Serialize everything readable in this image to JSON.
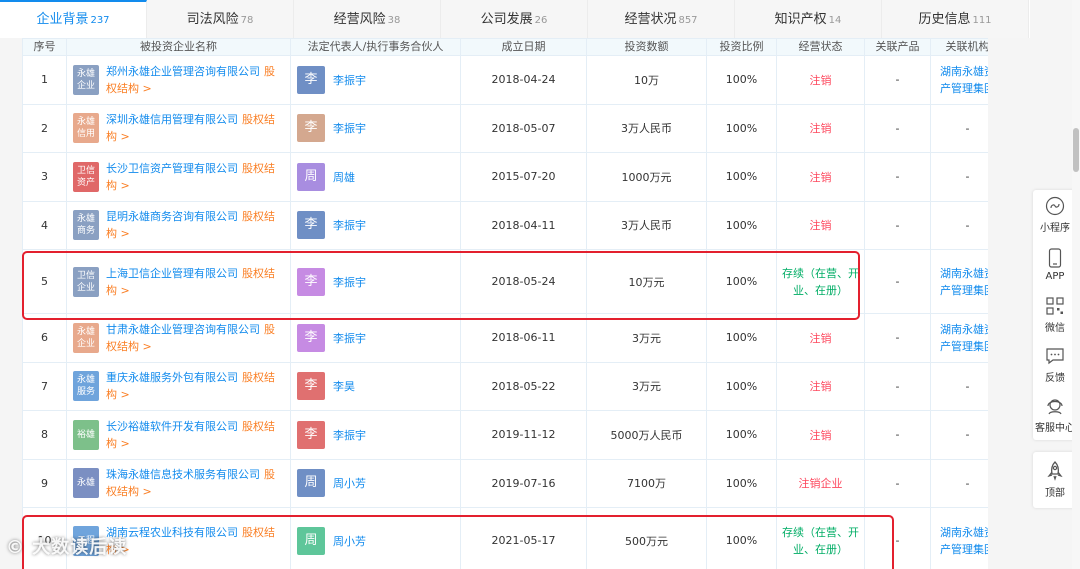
{
  "tabs": [
    {
      "label": "企业背景",
      "count": "237",
      "active": true
    },
    {
      "label": "司法风险",
      "count": "78"
    },
    {
      "label": "经营风险",
      "count": "38"
    },
    {
      "label": "公司发展",
      "count": "26"
    },
    {
      "label": "经营状况",
      "count": "857"
    },
    {
      "label": "知识产权",
      "count": "14"
    },
    {
      "label": "历史信息",
      "count": "111"
    }
  ],
  "table": {
    "headers": [
      "序号",
      "被投资企业名称",
      "法定代表人/执行事务合伙人",
      "成立日期",
      "投资数额",
      "投资比例",
      "经营状态",
      "关联产品",
      "关联机构"
    ],
    "equity_label": "股权结构 >",
    "rows": [
      {
        "no": "1",
        "logo": "永雄企业",
        "logo_color": "#8aa0c2",
        "name": "郑州永雄企业管理咨询有限公司",
        "avatar": "李",
        "avatar_color": "#6f8fc5",
        "person": "李振宇",
        "date": "2018-04-24",
        "amount": "10万",
        "ratio": "100%",
        "status": "注销",
        "status_type": "red",
        "product": "-",
        "org": "湖南永雄资产管理集团"
      },
      {
        "no": "2",
        "logo": "永雄信用",
        "logo_color": "#e8a98c",
        "name": "深圳永雄信用管理有限公司",
        "avatar": "李",
        "avatar_color": "#d4a88f",
        "person": "李振宇",
        "date": "2018-05-07",
        "amount": "3万人民币",
        "ratio": "100%",
        "status": "注销",
        "status_type": "red",
        "product": "-",
        "org": "-"
      },
      {
        "no": "3",
        "logo": "卫信资产",
        "logo_color": "#e06868",
        "name": "长沙卫信资产管理有限公司",
        "avatar": "周",
        "avatar_color": "#a88de0",
        "person": "周雄",
        "date": "2015-07-20",
        "amount": "1000万元",
        "ratio": "100%",
        "status": "注销",
        "status_type": "red",
        "product": "-",
        "org": "-"
      },
      {
        "no": "4",
        "logo": "永雄商务",
        "logo_color": "#8aa0c2",
        "name": "昆明永雄商务咨询有限公司",
        "avatar": "李",
        "avatar_color": "#6f8fc5",
        "person": "李振宇",
        "date": "2018-04-11",
        "amount": "3万人民币",
        "ratio": "100%",
        "status": "注销",
        "status_type": "red",
        "product": "-",
        "org": "-"
      },
      {
        "no": "5",
        "logo": "卫信企业",
        "logo_color": "#8aa0c2",
        "name": "上海卫信企业管理有限公司",
        "avatar": "李",
        "avatar_color": "#c68be3",
        "person": "李振宇",
        "date": "2018-05-24",
        "amount": "10万元",
        "ratio": "100%",
        "status": "存续（在营、开业、在册）",
        "status_type": "green",
        "product": "-",
        "org": "湖南永雄资产管理集团"
      },
      {
        "no": "6",
        "logo": "永雄企业",
        "logo_color": "#e8a98c",
        "name": "甘肃永雄企业管理咨询有限公司",
        "avatar": "李",
        "avatar_color": "#c68be3",
        "person": "李振宇",
        "date": "2018-06-11",
        "amount": "3万元",
        "ratio": "100%",
        "status": "注销",
        "status_type": "red",
        "product": "-",
        "org": "湖南永雄资产管理集团"
      },
      {
        "no": "7",
        "logo": "永雄服务",
        "logo_color": "#6fa4dc",
        "name": "重庆永雄服务外包有限公司",
        "avatar": "李",
        "avatar_color": "#e07070",
        "person": "李昊",
        "date": "2018-05-22",
        "amount": "3万元",
        "ratio": "100%",
        "status": "注销",
        "status_type": "red",
        "product": "-",
        "org": "-"
      },
      {
        "no": "8",
        "logo": "裕雄",
        "logo_color": "#7dc08a",
        "name": "长沙裕雄软件开发有限公司",
        "avatar": "李",
        "avatar_color": "#e07070",
        "person": "李振宇",
        "date": "2019-11-12",
        "amount": "5000万人民币",
        "ratio": "100%",
        "status": "注销",
        "status_type": "red",
        "product": "-",
        "org": "-"
      },
      {
        "no": "9",
        "logo": "永雄",
        "logo_color": "#7b8fc2",
        "name": "珠海永雄信息技术服务有限公司",
        "avatar": "周",
        "avatar_color": "#6f8fc5",
        "person": "周小芳",
        "date": "2019-07-16",
        "amount": "7100万",
        "ratio": "100%",
        "status": "注销企业",
        "status_type": "red",
        "product": "-",
        "org": "-"
      },
      {
        "no": "10",
        "logo": "云程",
        "logo_color": "#6fa4dc",
        "name": "湖南云程农业科技有限公司",
        "avatar": "周",
        "avatar_color": "#5ec69a",
        "person": "周小芳",
        "date": "2021-05-17",
        "amount": "500万元",
        "ratio": "100%",
        "status": "存续（在营、开业、在册）",
        "status_type": "green",
        "product": "-",
        "org": "湖南永雄资产管理集团"
      }
    ]
  },
  "sidebar": {
    "items": [
      {
        "label": "小程序",
        "icon": "mini-program-icon"
      },
      {
        "label": "APP",
        "icon": "phone-icon"
      },
      {
        "label": "微信",
        "icon": "qrcode-icon"
      },
      {
        "label": "反馈",
        "icon": "chat-icon"
      },
      {
        "label": "客服中心",
        "icon": "headset-icon"
      }
    ],
    "top_label": "顶部"
  },
  "watermark": "大数读后读"
}
